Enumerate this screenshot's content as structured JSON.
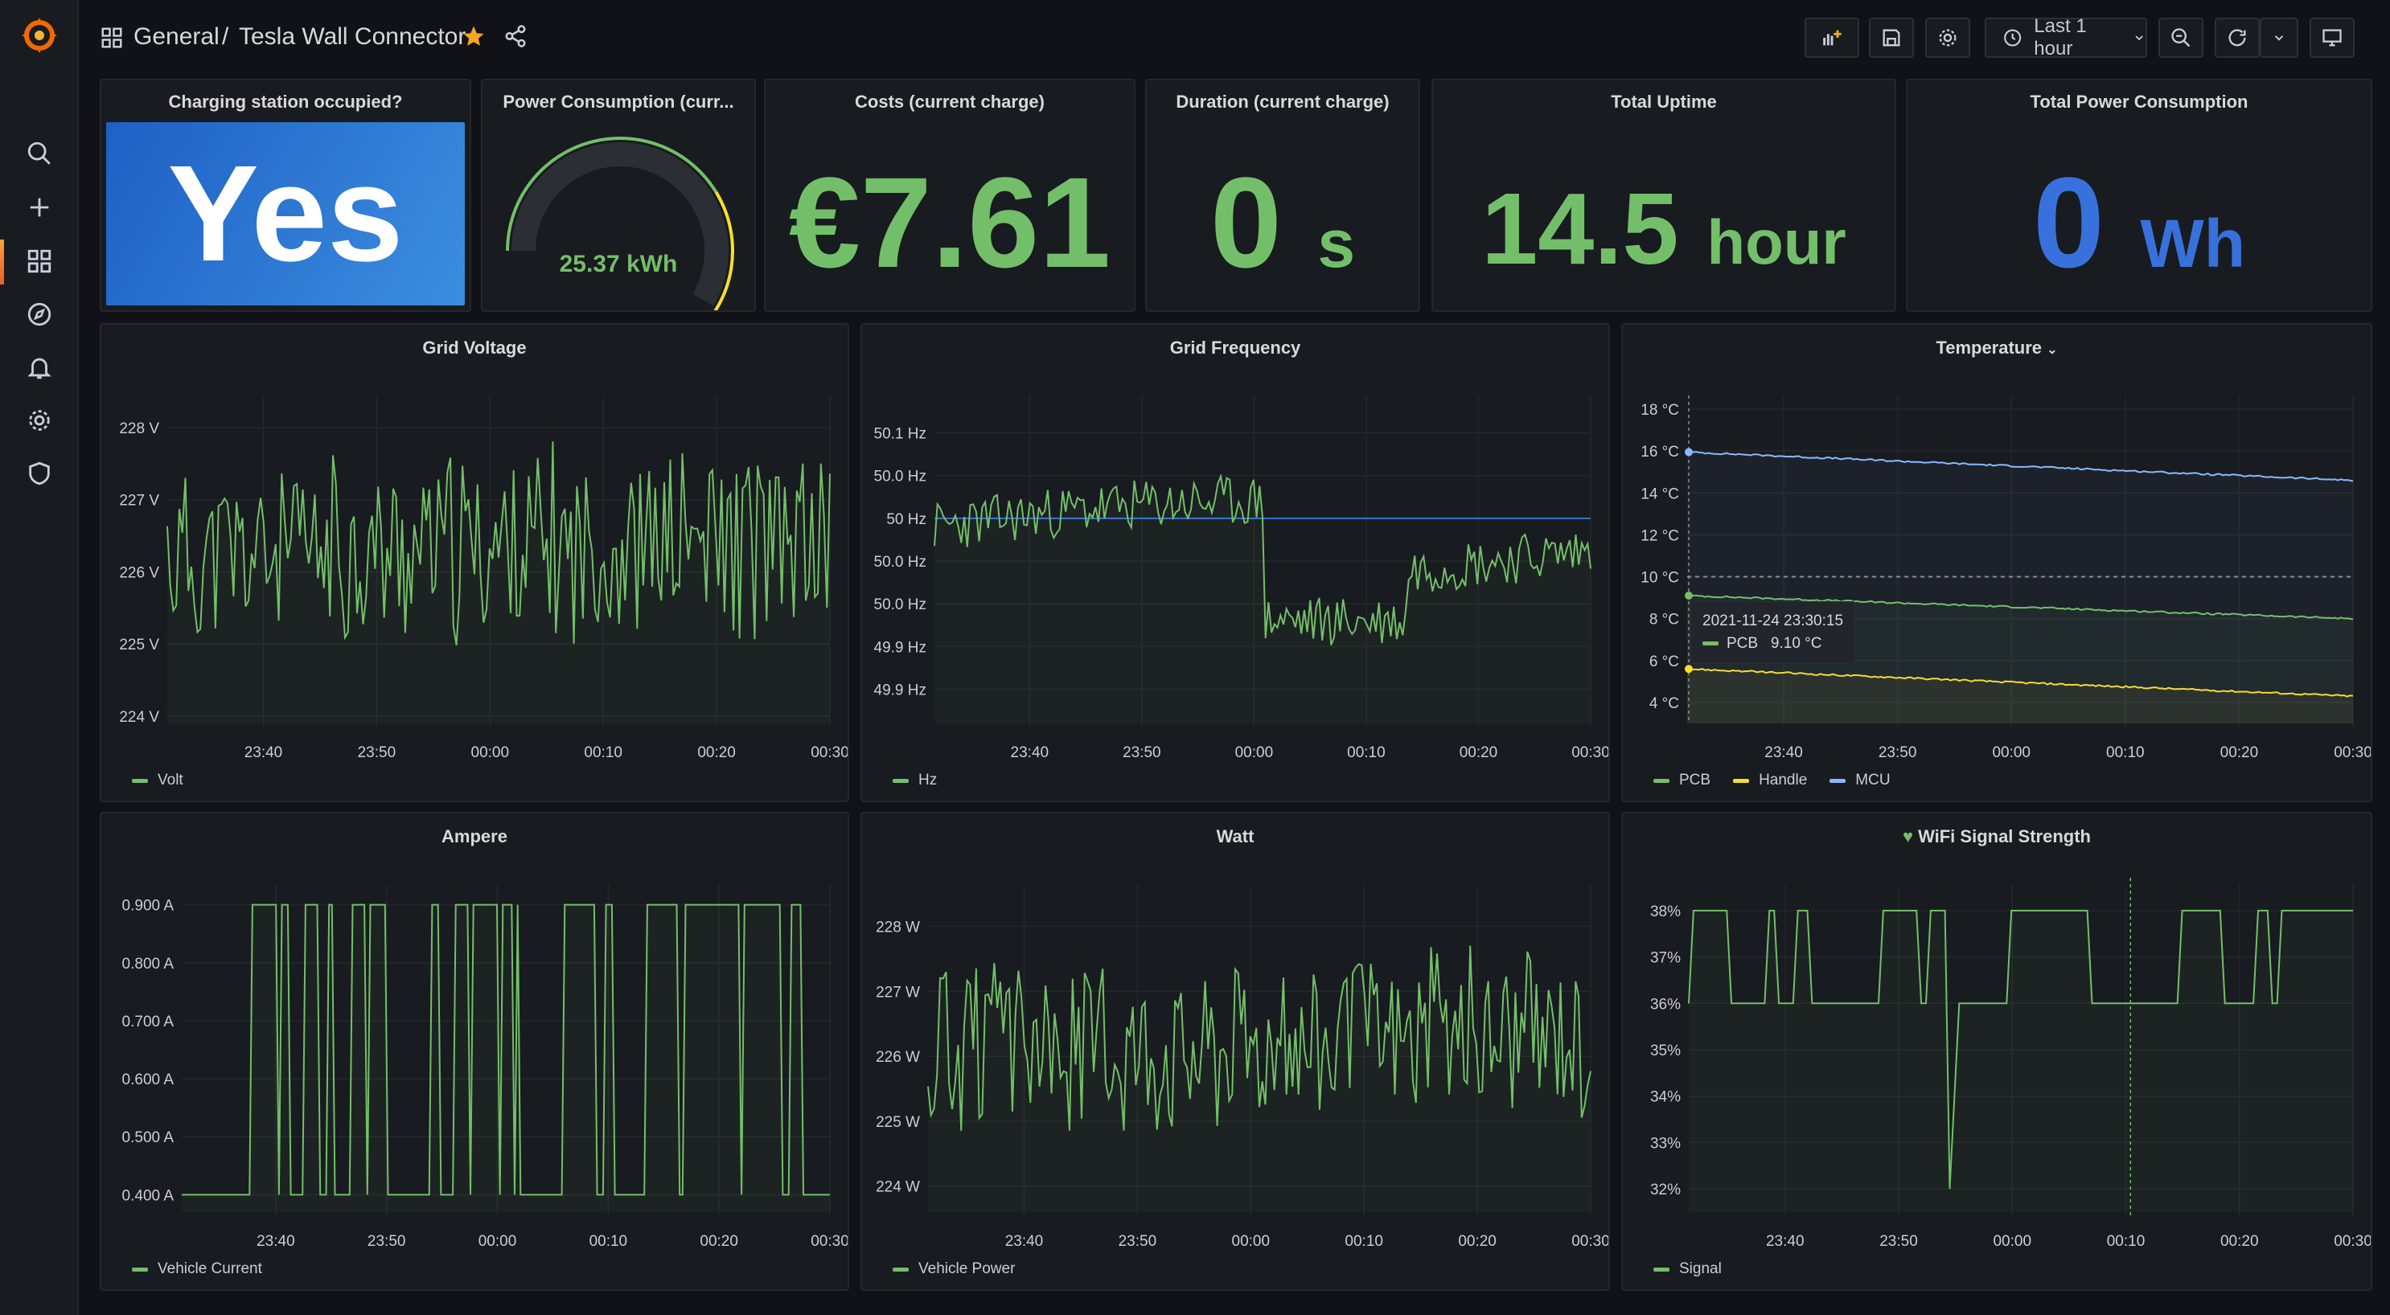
{
  "header": {
    "section": "General",
    "separator": "/",
    "title": "Tesla Wall Connector",
    "time_range": "Last 1 hour"
  },
  "sidebar": {
    "items": [
      "search",
      "create",
      "dashboards",
      "explore",
      "alerting",
      "configuration",
      "server-admin"
    ]
  },
  "colors": {
    "green": "#73bf69",
    "blue": "#3871dc",
    "yellow": "#fade2a",
    "lightblue": "#8ab8ff",
    "panel": "#181b1f"
  },
  "stats": {
    "occupied": {
      "title": "Charging station occupied?",
      "value": "Yes"
    },
    "power": {
      "title": "Power Consumption (curr...",
      "value": "25.37 kWh",
      "gauge_fraction": 0.78
    },
    "costs": {
      "title": "Costs (current charge)",
      "value": "€7.61"
    },
    "duration": {
      "title": "Duration (current charge)",
      "value": "0",
      "unit": "s"
    },
    "uptime": {
      "title": "Total Uptime",
      "value": "14.5",
      "unit": "hour"
    },
    "total_power": {
      "title": "Total Power Consumption",
      "value": "0",
      "unit": "Wh"
    }
  },
  "x_ticks": [
    "23:40",
    "23:50",
    "00:00",
    "00:10",
    "00:20",
    "00:30"
  ],
  "chart_data": [
    {
      "id": "voltage",
      "type": "line",
      "title": "Grid Voltage",
      "ylabels": [
        "228 V",
        "227 V",
        "226 V",
        "225 V",
        "224 V"
      ],
      "yticks": [
        228,
        227,
        226,
        225,
        224
      ],
      "ylim": [
        223.9,
        228.4
      ],
      "series": [
        {
          "name": "Volt",
          "color": "#73bf69",
          "seed": 11,
          "base": 226.2,
          "amp": 1.5,
          "trend": 0.25
        }
      ]
    },
    {
      "id": "frequency",
      "type": "line",
      "title": "Grid Frequency",
      "ylabels": [
        "50.1 Hz",
        "50.0 Hz",
        "50 Hz",
        "50.0 Hz",
        "50.0 Hz",
        "49.9 Hz",
        "49.9 Hz"
      ],
      "yticks": [
        50.1,
        50.075,
        50.05,
        50.025,
        50.0,
        49.975,
        49.95
      ],
      "ylim": [
        49.93,
        50.12
      ],
      "series": [
        {
          "name": "Hz",
          "color": "#73bf69",
          "seed": 23,
          "base": 50.04,
          "amp": 0.02,
          "trend": 0
        }
      ],
      "threshold": 50.05
    },
    {
      "id": "temperature",
      "type": "line",
      "title": "Temperature",
      "ylabels": [
        "18 °C",
        "16 °C",
        "14 °C",
        "12 °C",
        "10 °C",
        "8 °C",
        "6 °C",
        "4 °C"
      ],
      "yticks": [
        18,
        16,
        14,
        12,
        10,
        8,
        6,
        4
      ],
      "ylim": [
        3,
        18.5
      ],
      "series": [
        {
          "name": "PCB",
          "color": "#73bf69",
          "start": 9.1,
          "end": 8.0
        },
        {
          "name": "Handle",
          "color": "#fade2a",
          "start": 5.6,
          "end": 4.3
        },
        {
          "name": "MCU",
          "color": "#8ab8ff",
          "start": 15.95,
          "end": 14.6
        }
      ],
      "threshold": 10,
      "tooltip": {
        "time": "2021-11-24 23:30:15",
        "series": "PCB",
        "value": "9.10 °C"
      }
    },
    {
      "id": "ampere",
      "type": "line",
      "title": "Ampere",
      "ylabels": [
        "0.900 A",
        "0.800 A",
        "0.700 A",
        "0.600 A",
        "0.500 A",
        "0.400 A"
      ],
      "yticks": [
        0.9,
        0.8,
        0.7,
        0.6,
        0.5,
        0.4
      ],
      "ylim": [
        0.37,
        0.93
      ],
      "series": [
        {
          "name": "Vehicle Current",
          "color": "#73bf69",
          "seed": 37,
          "base": 0.4,
          "amp": 0.5
        }
      ]
    },
    {
      "id": "watt",
      "type": "line",
      "title": "Watt",
      "ylabels": [
        "228 W",
        "227 W",
        "226 W",
        "225 W",
        "224 W"
      ],
      "yticks": [
        228,
        227,
        226,
        225,
        224
      ],
      "ylim": [
        223.6,
        228.6
      ],
      "series": [
        {
          "name": "Vehicle Power",
          "color": "#73bf69",
          "seed": 51,
          "base": 226.1,
          "amp": 1.5,
          "trend": 0.3
        }
      ]
    },
    {
      "id": "wifi",
      "type": "line",
      "title": "WiFi Signal Strength",
      "ylabels": [
        "38%",
        "37%",
        "36%",
        "35%",
        "34%",
        "33%",
        "32%"
      ],
      "yticks": [
        38,
        37,
        36,
        35,
        34,
        33,
        32
      ],
      "ylim": [
        31.5,
        38.5
      ],
      "series": [
        {
          "name": "Signal",
          "color": "#73bf69",
          "seed": 77,
          "base": 36,
          "amp": 2
        }
      ]
    }
  ]
}
